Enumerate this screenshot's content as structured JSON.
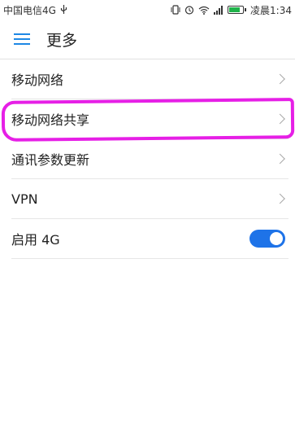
{
  "status_bar": {
    "carrier": "中国电信4G",
    "time": "凌晨1:34",
    "icons": [
      "usb-icon",
      "vibrate-icon",
      "alarm-icon",
      "wifi-icon",
      "signal-icon",
      "battery-icon"
    ]
  },
  "header": {
    "title": "更多",
    "menu_icon": "hamburger-menu-icon"
  },
  "settings": {
    "items": [
      {
        "label": "移动网络",
        "control": "chevron"
      },
      {
        "label": "移动网络共享",
        "control": "chevron"
      },
      {
        "label": "通讯参数更新",
        "control": "chevron"
      },
      {
        "label": "VPN",
        "control": "chevron"
      },
      {
        "label": "启用 4G",
        "control": "toggle",
        "enabled": true
      }
    ]
  },
  "colors": {
    "accent": "#1e73e8",
    "highlight": "#e61fe6",
    "battery": "#1fb34a"
  }
}
